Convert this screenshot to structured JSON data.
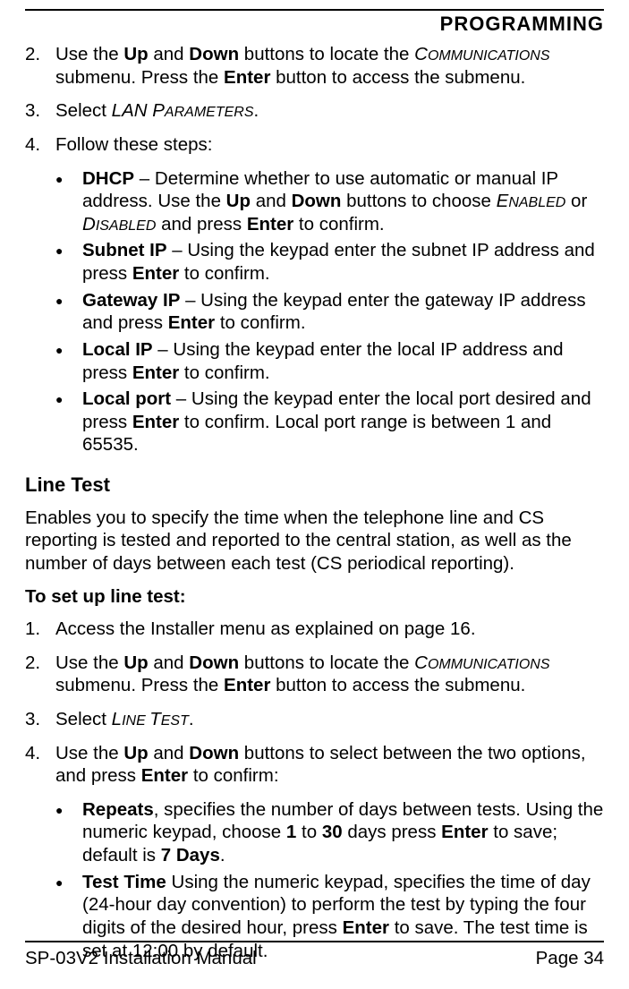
{
  "header": {
    "title": "PROGRAMMING"
  },
  "steps1": {
    "item2_num": "2.",
    "item2_pre": "Use the ",
    "item2_up": "Up",
    "item2_mid1": " and ",
    "item2_down": "Down",
    "item2_mid2": " buttons to locate the ",
    "item2_comm_c": "C",
    "item2_comm_rest": "OMMUNICATIONS",
    "item2_mid3": " submenu. Press the ",
    "item2_enter": "Enter",
    "item2_end": " button to access the submenu.",
    "item3_num": "3.",
    "item3_pre": "Select ",
    "item3_lan": "LAN P",
    "item3_params": "ARAMETERS",
    "item3_end": ".",
    "item4_num": "4.",
    "item4_text": "Follow these steps:"
  },
  "bullets1": {
    "dhcp_label": "DHCP",
    "dhcp_pre": " – Determine whether to use automatic or manual IP address. Use the ",
    "dhcp_up": "Up",
    "dhcp_mid1": " and ",
    "dhcp_down": "Down",
    "dhcp_mid2": " buttons to choose ",
    "dhcp_en_e": "E",
    "dhcp_en_rest": "NABLED",
    "dhcp_or": " or ",
    "dhcp_dis_d": "D",
    "dhcp_dis_rest": "ISABLED",
    "dhcp_mid3": " and press ",
    "dhcp_enter": "Enter",
    "dhcp_end": " to confirm.",
    "subnet_label": "Subnet IP",
    "subnet_pre": " – Using the keypad enter the subnet IP address and press ",
    "subnet_enter": "Enter",
    "subnet_end": " to confirm.",
    "gateway_label": "Gateway IP",
    "gateway_pre": " – Using the keypad enter the gateway IP address and press ",
    "gateway_enter": "Enter",
    "gateway_end": " to confirm.",
    "localip_label": "Local IP",
    "localip_pre": " – Using the keypad enter the local IP address and press ",
    "localip_enter": "Enter",
    "localip_end": " to confirm.",
    "localport_label": "Local port",
    "localport_pre": " – Using the keypad enter the local port desired and press ",
    "localport_enter": "Enter",
    "localport_end": " to confirm. Local port range is between 1 and 65535."
  },
  "section2": {
    "heading": "Line Test",
    "intro": "Enables you to specify the time when the telephone line and CS reporting is tested and reported to the central station, as well as the number of days between each test (CS periodical reporting).",
    "subheading": "To set up line test:"
  },
  "steps2": {
    "item1_num": "1.",
    "item1_text": "Access the Installer menu as explained on page 16.",
    "item2_num": "2.",
    "item2_pre": "Use the ",
    "item2_up": "Up",
    "item2_mid1": " and ",
    "item2_down": "Down",
    "item2_mid2": " buttons to locate the ",
    "item2_comm_c": "C",
    "item2_comm_rest": "OMMUNICATIONS",
    "item2_mid3": " submenu. Press the ",
    "item2_enter": "Enter",
    "item2_end": " button to access the submenu.",
    "item3_num": "3.",
    "item3_pre": "Select ",
    "item3_lt_l": "L",
    "item3_lt_ine": "INE ",
    "item3_lt_t": "T",
    "item3_lt_est": "EST",
    "item3_end": ".",
    "item4_num": "4.",
    "item4_pre": "Use the ",
    "item4_up": "Up",
    "item4_mid1": " and ",
    "item4_down": "Down",
    "item4_mid2": " buttons to select between the two options, and press ",
    "item4_enter": "Enter",
    "item4_end": " to confirm:"
  },
  "bullets2": {
    "repeats_label": "Repeats",
    "repeats_pre": ", specifies the number of days between tests. Using the numeric keypad, choose ",
    "repeats_1": "1",
    "repeats_to": " to ",
    "repeats_30": "30",
    "repeats_mid": " days press ",
    "repeats_enter": "Enter",
    "repeats_mid2": " to save; default is ",
    "repeats_7days": "7 Days",
    "repeats_end": ".",
    "tt_label": "Test Time",
    "tt_pre": " Using the numeric keypad, specifies the time of day (24-hour day convention) to perform the test by typing the four digits of the desired hour, press ",
    "tt_enter": "Enter",
    "tt_end": " to save. The test time is set at 12:00 by default."
  },
  "footer": {
    "left": "SP-03V2 Installation Manual",
    "right": "Page 34"
  }
}
